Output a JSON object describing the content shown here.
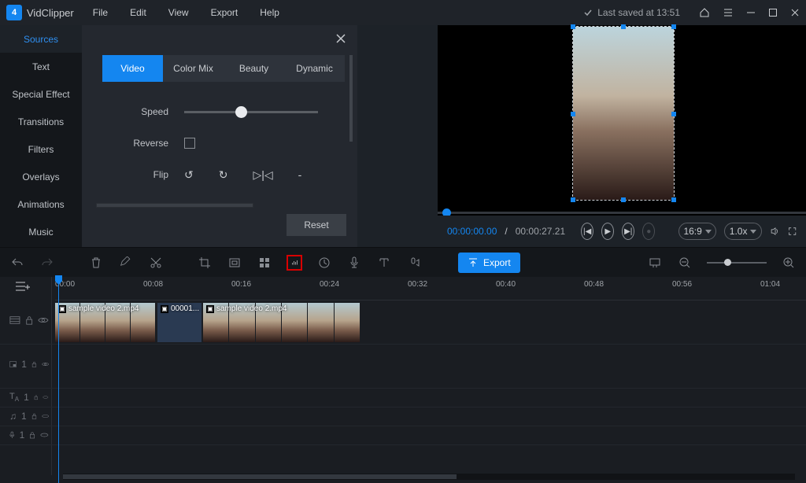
{
  "app": {
    "name": "VidClipper"
  },
  "menu": [
    "File",
    "Edit",
    "View",
    "Export",
    "Help"
  ],
  "status": {
    "last_saved": "Last saved at 13:51"
  },
  "sidebar": [
    "Sources",
    "Text",
    "Special Effect",
    "Transitions",
    "Filters",
    "Overlays",
    "Animations",
    "Music"
  ],
  "panel": {
    "tabs": [
      "Video",
      "Color Mix",
      "Beauty",
      "Dynamic"
    ],
    "speed": "Speed",
    "reverse": "Reverse",
    "flip": "Flip",
    "reset": "Reset"
  },
  "preview": {
    "current": "00:00:00.00",
    "total": "00:00:27.21",
    "aspect": "16:9",
    "speed": "1.0x"
  },
  "toolbar": {
    "export": "Export"
  },
  "ruler": [
    "00:00",
    "00:08",
    "00:16",
    "00:24",
    "00:32",
    "00:40",
    "00:48",
    "00:56",
    "01:04"
  ],
  "clips": {
    "a": "sample video 2.mp4",
    "b": "00001...",
    "c": "sample video 2.mp4"
  }
}
